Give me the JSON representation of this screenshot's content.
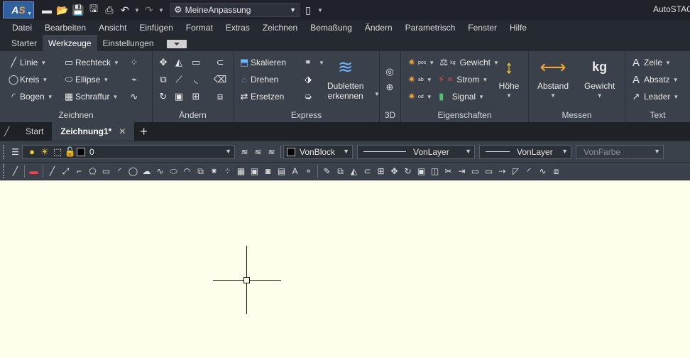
{
  "app": {
    "logo_text_a": "A",
    "logo_text_s": "S",
    "title": "AutoSTAGE",
    "workspace": "MeineAnpassung"
  },
  "quick_access": {
    "icons": [
      "new-file-icon",
      "open-folder-icon",
      "save-icon",
      "save-as-icon",
      "print-icon",
      "undo-icon",
      "redo-icon",
      "workspace-gear-icon",
      "device-icon"
    ]
  },
  "menu": [
    "Datei",
    "Bearbeiten",
    "Ansicht",
    "Einfügen",
    "Format",
    "Extras",
    "Zeichnen",
    "Bemaßung",
    "Ändern",
    "Parametrisch",
    "Fenster",
    "Hilfe"
  ],
  "ribbon_tabs": [
    "Starter",
    "Werkzeuge",
    "Einstellungen"
  ],
  "ribbon_active_tab": "Werkzeuge",
  "panels": {
    "zeichnen": {
      "title": "Zeichnen",
      "linie": "Linie",
      "kreis": "Kreis",
      "bogen": "Bogen",
      "rechteck": "Rechteck",
      "ellipse": "Ellipse",
      "schraffur": "Schraffur"
    },
    "aendern": {
      "title": "Ändern"
    },
    "express": {
      "title": "Express",
      "skalieren": "Skalieren",
      "drehen": "Drehen",
      "ersetzen": "Ersetzen",
      "dubletten_1": "Dubletten",
      "dubletten_2": "erkennen"
    },
    "d3": {
      "title": "3D"
    },
    "eigenschaften": {
      "title": "Eigenschaften",
      "gewicht": "Gewicht",
      "strom": "Strom",
      "signal": "Signal",
      "hoehe": "Höhe",
      "label_pos": "pos",
      "label_kg": "kg",
      "label_ab": "ab",
      "label_w": "W",
      "label_od": "od"
    },
    "messen": {
      "title": "Messen",
      "abstand": "Abstand",
      "gewicht": "Gewicht",
      "kg_label": "kg"
    },
    "text": {
      "title": "Text",
      "zeile": "Zeile",
      "absatz": "Absatz",
      "leader": "Leader"
    }
  },
  "file_tabs": {
    "start": "Start",
    "active": "Zeichnung1*",
    "close": "✕",
    "add": "+"
  },
  "properties": {
    "layer": "0",
    "color": "VonBlock",
    "linetype": "VonLayer",
    "lineweight": "VonLayer",
    "plotstyle": "VonFarbe"
  },
  "colors": {
    "canvas": "#fffdeb",
    "ribbon": "#3b414a",
    "titlebar": "#1f2329"
  }
}
